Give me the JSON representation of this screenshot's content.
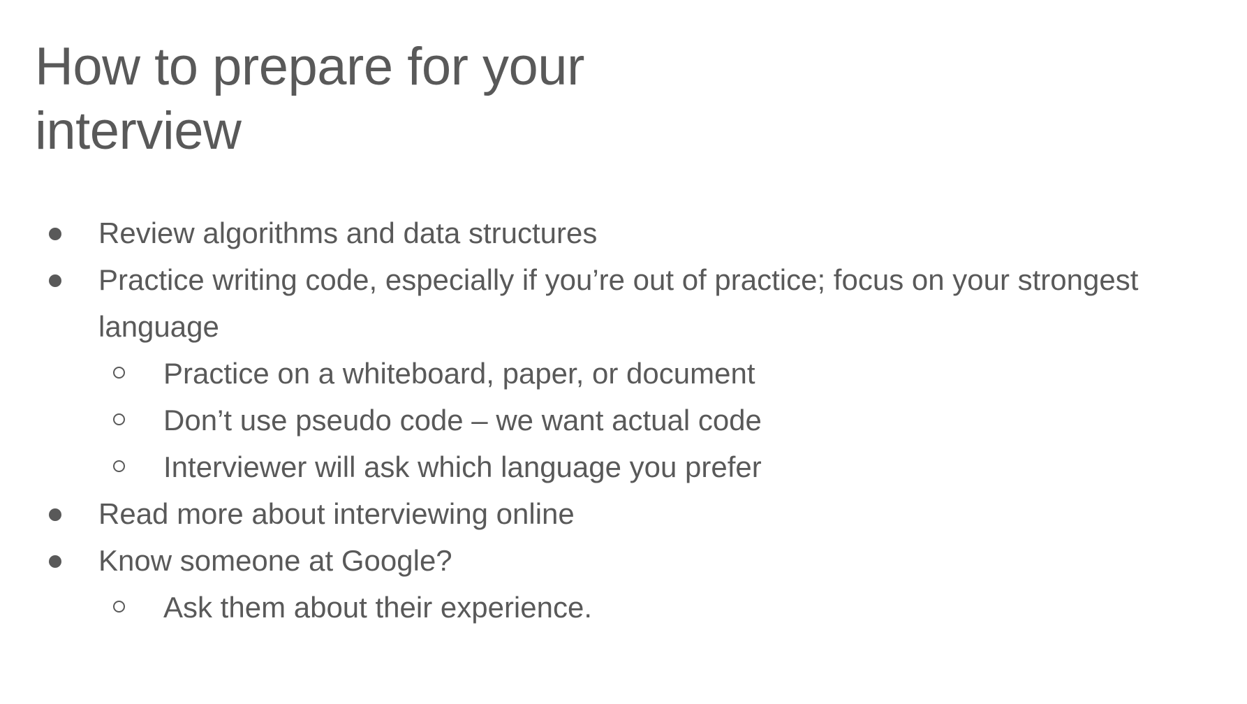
{
  "slide": {
    "title_line1": "How to prepare for your",
    "title_line2": "interview",
    "bullets": [
      {
        "text": "Review algorithms and data structures",
        "sub": []
      },
      {
        "text": "Practice writing code, especially if you’re out of practice; focus on your strongest language",
        "sub": [
          "Practice on a whiteboard, paper, or document",
          "Don’t use pseudo code – we want actual code",
          "Interviewer will ask which language you prefer"
        ]
      },
      {
        "text": "Read more about interviewing online",
        "sub": []
      },
      {
        "text": "Know someone at Google?",
        "sub": [
          "Ask them about their experience."
        ]
      }
    ],
    "colors": {
      "text": "#595959",
      "background": "#ffffff"
    }
  }
}
